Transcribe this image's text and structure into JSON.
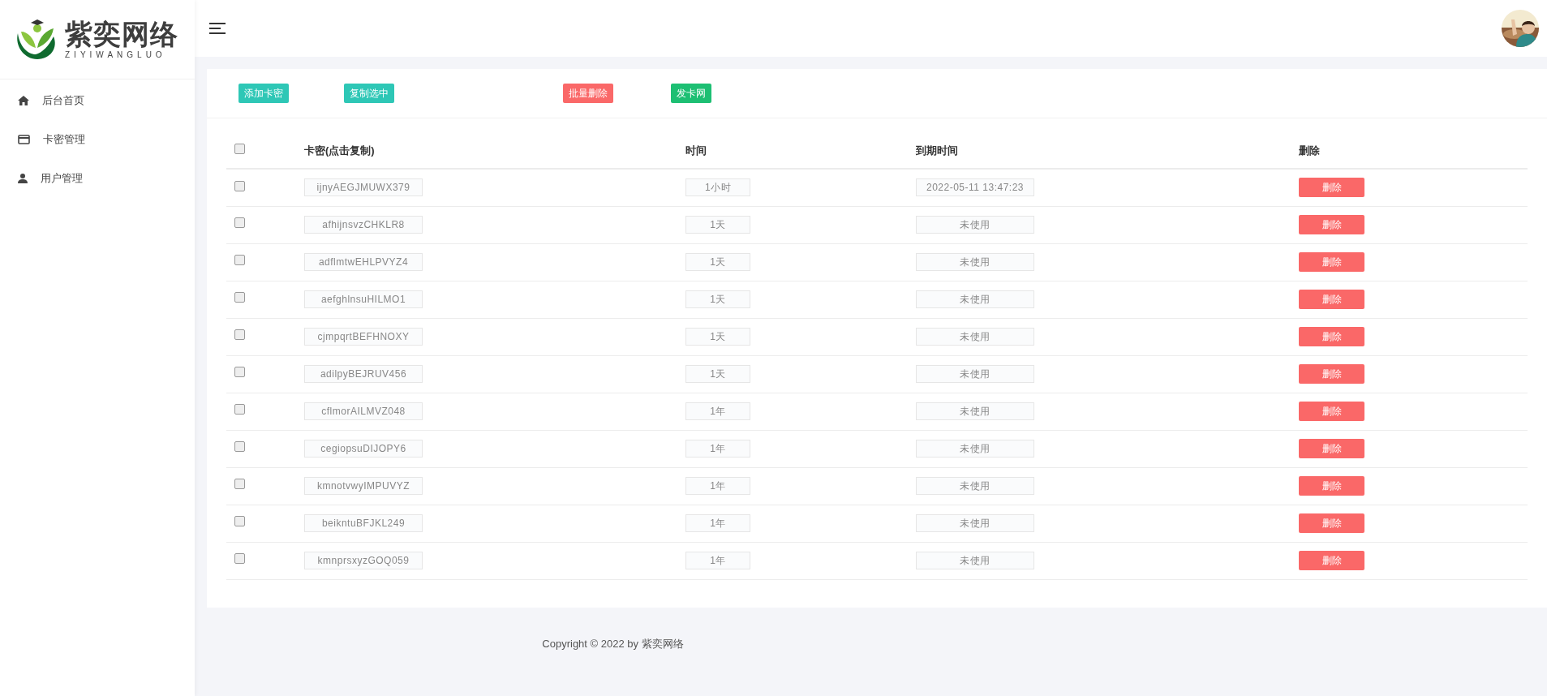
{
  "logo": {
    "title": "紫奕网络",
    "subtitle": "ZIYIWANGLUO"
  },
  "sidebar": {
    "items": [
      {
        "label": "后台首页",
        "kind": "home",
        "selected": false
      },
      {
        "label": "卡密管理",
        "kind": "card",
        "selected": false
      },
      {
        "label": "用户管理",
        "kind": "user",
        "selected": false
      }
    ]
  },
  "toolbar": {
    "buttons": [
      {
        "label": "添加卡密",
        "kind": "teal"
      },
      {
        "label": "复制选中",
        "kind": "teal"
      },
      {
        "label": "批量删除",
        "kind": "danger"
      },
      {
        "label": "发卡网",
        "kind": "green"
      }
    ]
  },
  "table": {
    "select_all": {
      "checked": false
    },
    "columns": [
      "卡密(点击复制)",
      "时间",
      "到期时间",
      "删除"
    ],
    "rows": [
      {
        "checked": false,
        "key": "ijnyAEGJMUWX379",
        "duration": "1小时",
        "expires": "2022-05-11 13:47:23",
        "action": "删除"
      },
      {
        "checked": false,
        "key": "afhijnsvzCHKLR8",
        "duration": "1天",
        "expires": "未使用",
        "action": "删除"
      },
      {
        "checked": false,
        "key": "adflmtwEHLPVYZ4",
        "duration": "1天",
        "expires": "未使用",
        "action": "删除"
      },
      {
        "checked": false,
        "key": "aefghlnsuHILMO1",
        "duration": "1天",
        "expires": "未使用",
        "action": "删除"
      },
      {
        "checked": false,
        "key": "cjmpqrtBEFHNOXY",
        "duration": "1天",
        "expires": "未使用",
        "action": "删除"
      },
      {
        "checked": false,
        "key": "adilpyBEJRUV456",
        "duration": "1天",
        "expires": "未使用",
        "action": "删除"
      },
      {
        "checked": false,
        "key": "cflmorAILMVZ048",
        "duration": "1年",
        "expires": "未使用",
        "action": "删除"
      },
      {
        "checked": false,
        "key": "cegiopsuDIJOPY6",
        "duration": "1年",
        "expires": "未使用",
        "action": "删除"
      },
      {
        "checked": false,
        "key": "kmnotvwyIMPUVYZ",
        "duration": "1年",
        "expires": "未使用",
        "action": "删除"
      },
      {
        "checked": false,
        "key": "beikntuBFJKL249",
        "duration": "1年",
        "expires": "未使用",
        "action": "删除"
      },
      {
        "checked": false,
        "key": "kmnprsxyzGOQ059",
        "duration": "1年",
        "expires": "未使用",
        "action": "删除"
      }
    ]
  },
  "footer": {
    "copyright": "Copyright © 2022 by 紫奕网络"
  }
}
